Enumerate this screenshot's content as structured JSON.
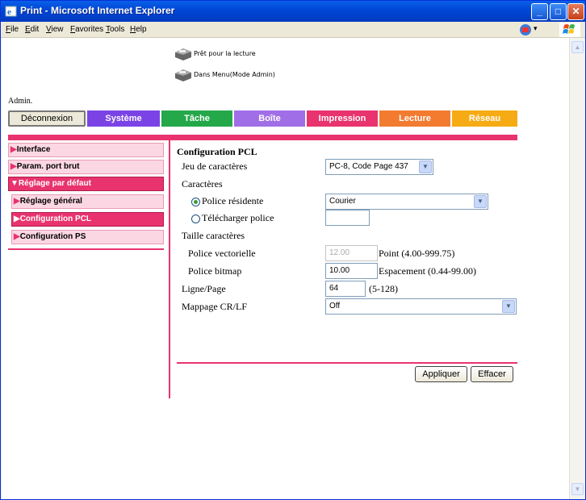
{
  "window": {
    "title": "Print - Microsoft Internet Explorer"
  },
  "menu": {
    "items": [
      "File",
      "Edit",
      "View",
      "Favorites",
      "Tools",
      "Help"
    ]
  },
  "status": {
    "line1": "Prêt pour la lecture",
    "line2": "Dans Menu(Mode Admin)"
  },
  "admin_label": "Admin.",
  "tabs": [
    {
      "label": "Déconnexion",
      "color": "#ece9d8"
    },
    {
      "label": "Système",
      "color": "#7b43e6"
    },
    {
      "label": "Tâche",
      "color": "#25a84a"
    },
    {
      "label": "Boîte",
      "color": "#a06ee6"
    },
    {
      "label": "Impression",
      "color": "#e8336e"
    },
    {
      "label": "Lecture",
      "color": "#f27b30"
    },
    {
      "label": "Réseau",
      "color": "#f6ab14"
    }
  ],
  "nav": {
    "items": [
      {
        "label": "Interface",
        "marker": "▶"
      },
      {
        "label": "Param. port brut",
        "marker": "▶"
      },
      {
        "label": "Réglage par défaut",
        "marker": "▼"
      },
      {
        "label": "Réglage général",
        "marker": "▶"
      },
      {
        "label": "Configuration PCL",
        "marker": "▶"
      },
      {
        "label": "Configuration PS",
        "marker": "▶"
      }
    ]
  },
  "form": {
    "title": "Configuration PCL",
    "charset_label": "Jeu de caractères",
    "charset_value": "PC-8, Code Page 437",
    "characters_label": "Caractères",
    "resident_font_label": "Police résidente",
    "resident_font_value": "Courier",
    "download_font_label": "Télécharger police",
    "download_font_value": "",
    "char_size_label": "Taille caractères",
    "vector_font_label": "Police vectorielle",
    "vector_font_value": "12.00",
    "vector_font_hint": "Point (4.00-999.75)",
    "bitmap_font_label": "Police bitmap",
    "bitmap_font_value": "10.00",
    "bitmap_font_hint": "Espacement (0.44-99.00)",
    "lines_label": "Ligne/Page",
    "lines_value": "64",
    "lines_hint": "(5-128)",
    "crlf_label": "Mappage CR/LF",
    "crlf_value": "Off",
    "apply_label": "Appliquer",
    "clear_label": "Effacer"
  }
}
